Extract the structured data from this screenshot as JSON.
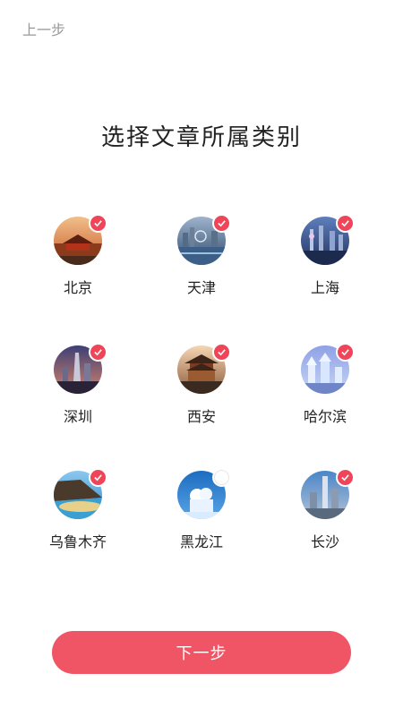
{
  "header": {
    "back_label": "上一步"
  },
  "title": "选择文章所属类别",
  "cities": [
    {
      "name": "北京",
      "selected": true,
      "theme": "forbidden-city"
    },
    {
      "name": "天津",
      "selected": true,
      "theme": "river-skyline"
    },
    {
      "name": "上海",
      "selected": true,
      "theme": "pudong-night"
    },
    {
      "name": "深圳",
      "selected": true,
      "theme": "night-tower"
    },
    {
      "name": "西安",
      "selected": true,
      "theme": "bell-tower"
    },
    {
      "name": "哈尔滨",
      "selected": true,
      "theme": "ice-palace"
    },
    {
      "name": "乌鲁木齐",
      "selected": true,
      "theme": "lake-cliff"
    },
    {
      "name": "黑龙江",
      "selected": false,
      "theme": "snow-sculpture"
    },
    {
      "name": "长沙",
      "selected": true,
      "theme": "city-tower"
    }
  ],
  "footer": {
    "next_label": "下一步"
  },
  "colors": {
    "accent": "#f05565",
    "check": "#f24458"
  }
}
